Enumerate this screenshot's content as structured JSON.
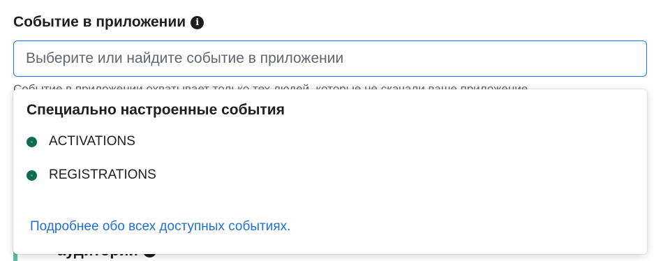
{
  "field": {
    "label": "Событие в приложении",
    "info_icon": "info-icon",
    "input_value": "",
    "input_placeholder": "Выберите или найдите событие в приложении"
  },
  "helper_text": "Событие в приложении охватывает только тех людей, которые не скачали ваше приложение.",
  "dropdown": {
    "heading": "Специально настроенные события",
    "events": [
      {
        "label": "ACTIVATIONS",
        "status_color": "#0e6b4e"
      },
      {
        "label": "REGISTRATIONS",
        "status_color": "#0e6b4e"
      }
    ],
    "learn_more": "Подробнее обо всех доступных событиях."
  },
  "behind_section": {
    "title": "аудитории",
    "info_icon": "info-icon"
  },
  "colors": {
    "accent": "#1877f2",
    "link": "#216fdb",
    "status": "#0e6b4e",
    "side_bar": "#5bc0a7"
  }
}
